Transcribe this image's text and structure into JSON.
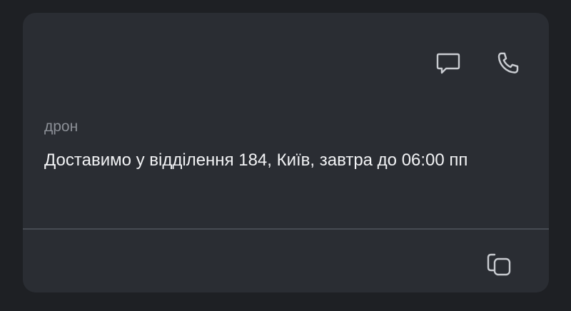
{
  "card": {
    "label": "дрон",
    "message": "Доставимо у відділення 184, Київ, завтра до 06:00 пп"
  },
  "actions": {
    "chat_icon": "chat-bubble-icon",
    "phone_icon": "phone-icon",
    "copy_icon": "copy-icon"
  },
  "colors": {
    "background": "#1e2024",
    "card": "#2a2d33",
    "icon": "#c9ccd1",
    "label": "#8c9097",
    "text": "#f2f3f5",
    "divider": "#474b53"
  }
}
